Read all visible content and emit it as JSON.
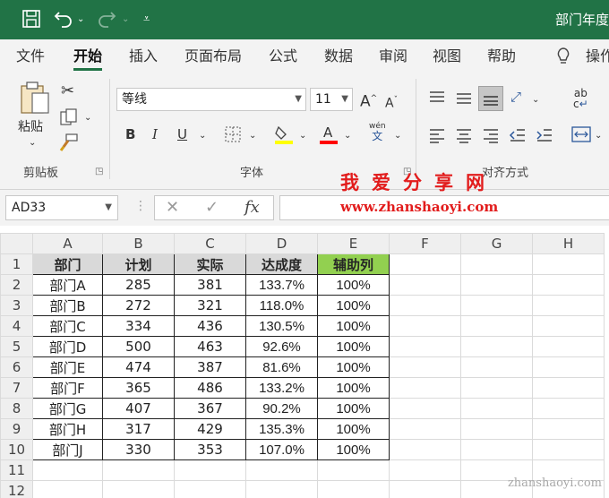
{
  "window": {
    "title": "部门年度"
  },
  "quick_access": {
    "save_icon": "save-icon",
    "undo_icon": "undo-icon",
    "redo_icon": "redo-icon",
    "customize_icon": "customize-icon"
  },
  "tabs": [
    "文件",
    "开始",
    "插入",
    "页面布局",
    "公式",
    "数据",
    "审阅",
    "视图",
    "帮助",
    "操作"
  ],
  "active_tab": "开始",
  "ribbon": {
    "clipboard": {
      "paste_label": "粘贴",
      "group_label": "剪贴板"
    },
    "font": {
      "font_name": "等线",
      "font_size": "11",
      "bold": "B",
      "italic": "I",
      "underline": "U",
      "phonetic": "wén",
      "phonetic_sub": "文",
      "group_label": "字体",
      "fill_color": "#ffff00",
      "font_color": "#ff0000"
    },
    "alignment": {
      "group_label": "对齐方式"
    }
  },
  "formula_bar": {
    "name_box": "AD33",
    "fx_label": "fx",
    "formula": ""
  },
  "watermark": {
    "cn": "我爱分享网",
    "url": "www.zhanshaoyi.com",
    "bottom": "zhanshaoyi.com"
  },
  "sheet": {
    "columns": [
      "A",
      "B",
      "C",
      "D",
      "E",
      "F",
      "G",
      "H"
    ],
    "row_numbers": [
      "1",
      "2",
      "3",
      "4",
      "5",
      "6",
      "7",
      "8",
      "9",
      "10",
      "11",
      "12"
    ],
    "header": [
      "部门",
      "计划",
      "实际",
      "达成度",
      "辅助列"
    ],
    "rows": [
      [
        "部门A",
        "285",
        "381",
        "133.7%",
        "100%"
      ],
      [
        "部门B",
        "272",
        "321",
        "118.0%",
        "100%"
      ],
      [
        "部门C",
        "334",
        "436",
        "130.5%",
        "100%"
      ],
      [
        "部门D",
        "500",
        "463",
        "92.6%",
        "100%"
      ],
      [
        "部门E",
        "474",
        "387",
        "81.6%",
        "100%"
      ],
      [
        "部门F",
        "365",
        "486",
        "133.2%",
        "100%"
      ],
      [
        "部门G",
        "407",
        "367",
        "90.2%",
        "100%"
      ],
      [
        "部门H",
        "317",
        "429",
        "135.3%",
        "100%"
      ],
      [
        "部门J",
        "330",
        "353",
        "107.0%",
        "100%"
      ]
    ],
    "header_fill": "#d9d9d9",
    "helper_fill": "#92d050"
  }
}
